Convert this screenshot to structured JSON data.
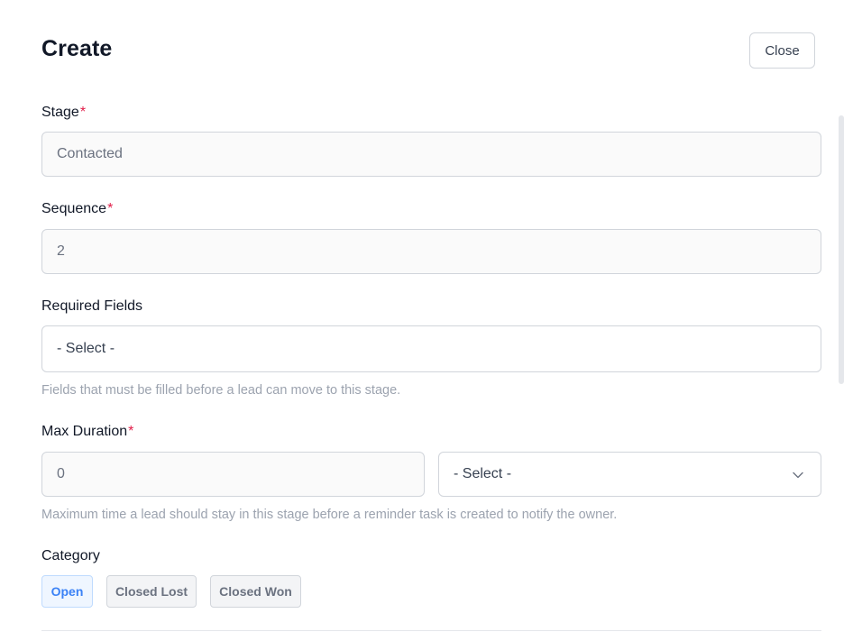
{
  "dialog": {
    "title": "Create",
    "close_label": "Close"
  },
  "fields": {
    "stage": {
      "label": "Stage",
      "required_mark": "*",
      "value": "Contacted"
    },
    "sequence": {
      "label": "Sequence",
      "required_mark": "*",
      "value": "2"
    },
    "required_fields": {
      "label": "Required Fields",
      "selected": "- Select -",
      "hint": "Fields that must be filled before a lead can move to this stage."
    },
    "max_duration": {
      "label": "Max Duration",
      "required_mark": "*",
      "value": "0",
      "unit_selected": "- Select -",
      "hint": "Maximum time a lead should stay in this stage before a reminder task is created to notify the owner."
    },
    "category": {
      "label": "Category",
      "options": [
        "Open",
        "Closed Lost",
        "Closed Won"
      ],
      "selected": "Open"
    }
  },
  "colors": {
    "required": "#e11d48",
    "active_chip_text": "#3b82f6",
    "active_chip_bg": "#eff6ff"
  },
  "icons": {
    "unit_dropdown": "chevron-down-icon"
  }
}
